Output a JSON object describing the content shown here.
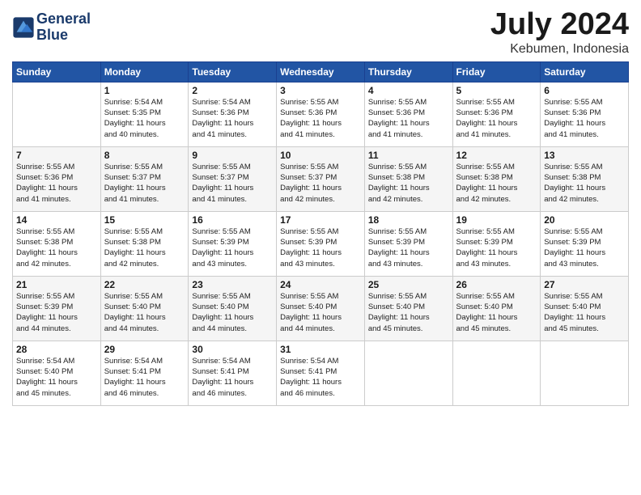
{
  "header": {
    "logo_line1": "General",
    "logo_line2": "Blue",
    "month_title": "July 2024",
    "location": "Kebumen, Indonesia"
  },
  "weekdays": [
    "Sunday",
    "Monday",
    "Tuesday",
    "Wednesday",
    "Thursday",
    "Friday",
    "Saturday"
  ],
  "weeks": [
    [
      {
        "day": "",
        "info": ""
      },
      {
        "day": "1",
        "info": "Sunrise: 5:54 AM\nSunset: 5:35 PM\nDaylight: 11 hours\nand 40 minutes."
      },
      {
        "day": "2",
        "info": "Sunrise: 5:54 AM\nSunset: 5:36 PM\nDaylight: 11 hours\nand 41 minutes."
      },
      {
        "day": "3",
        "info": "Sunrise: 5:55 AM\nSunset: 5:36 PM\nDaylight: 11 hours\nand 41 minutes."
      },
      {
        "day": "4",
        "info": "Sunrise: 5:55 AM\nSunset: 5:36 PM\nDaylight: 11 hours\nand 41 minutes."
      },
      {
        "day": "5",
        "info": "Sunrise: 5:55 AM\nSunset: 5:36 PM\nDaylight: 11 hours\nand 41 minutes."
      },
      {
        "day": "6",
        "info": "Sunrise: 5:55 AM\nSunset: 5:36 PM\nDaylight: 11 hours\nand 41 minutes."
      }
    ],
    [
      {
        "day": "7",
        "info": "Sunrise: 5:55 AM\nSunset: 5:36 PM\nDaylight: 11 hours\nand 41 minutes."
      },
      {
        "day": "8",
        "info": "Sunrise: 5:55 AM\nSunset: 5:37 PM\nDaylight: 11 hours\nand 41 minutes."
      },
      {
        "day": "9",
        "info": "Sunrise: 5:55 AM\nSunset: 5:37 PM\nDaylight: 11 hours\nand 41 minutes."
      },
      {
        "day": "10",
        "info": "Sunrise: 5:55 AM\nSunset: 5:37 PM\nDaylight: 11 hours\nand 42 minutes."
      },
      {
        "day": "11",
        "info": "Sunrise: 5:55 AM\nSunset: 5:38 PM\nDaylight: 11 hours\nand 42 minutes."
      },
      {
        "day": "12",
        "info": "Sunrise: 5:55 AM\nSunset: 5:38 PM\nDaylight: 11 hours\nand 42 minutes."
      },
      {
        "day": "13",
        "info": "Sunrise: 5:55 AM\nSunset: 5:38 PM\nDaylight: 11 hours\nand 42 minutes."
      }
    ],
    [
      {
        "day": "14",
        "info": "Sunrise: 5:55 AM\nSunset: 5:38 PM\nDaylight: 11 hours\nand 42 minutes."
      },
      {
        "day": "15",
        "info": "Sunrise: 5:55 AM\nSunset: 5:38 PM\nDaylight: 11 hours\nand 42 minutes."
      },
      {
        "day": "16",
        "info": "Sunrise: 5:55 AM\nSunset: 5:39 PM\nDaylight: 11 hours\nand 43 minutes."
      },
      {
        "day": "17",
        "info": "Sunrise: 5:55 AM\nSunset: 5:39 PM\nDaylight: 11 hours\nand 43 minutes."
      },
      {
        "day": "18",
        "info": "Sunrise: 5:55 AM\nSunset: 5:39 PM\nDaylight: 11 hours\nand 43 minutes."
      },
      {
        "day": "19",
        "info": "Sunrise: 5:55 AM\nSunset: 5:39 PM\nDaylight: 11 hours\nand 43 minutes."
      },
      {
        "day": "20",
        "info": "Sunrise: 5:55 AM\nSunset: 5:39 PM\nDaylight: 11 hours\nand 43 minutes."
      }
    ],
    [
      {
        "day": "21",
        "info": "Sunrise: 5:55 AM\nSunset: 5:39 PM\nDaylight: 11 hours\nand 44 minutes."
      },
      {
        "day": "22",
        "info": "Sunrise: 5:55 AM\nSunset: 5:40 PM\nDaylight: 11 hours\nand 44 minutes."
      },
      {
        "day": "23",
        "info": "Sunrise: 5:55 AM\nSunset: 5:40 PM\nDaylight: 11 hours\nand 44 minutes."
      },
      {
        "day": "24",
        "info": "Sunrise: 5:55 AM\nSunset: 5:40 PM\nDaylight: 11 hours\nand 44 minutes."
      },
      {
        "day": "25",
        "info": "Sunrise: 5:55 AM\nSunset: 5:40 PM\nDaylight: 11 hours\nand 45 minutes."
      },
      {
        "day": "26",
        "info": "Sunrise: 5:55 AM\nSunset: 5:40 PM\nDaylight: 11 hours\nand 45 minutes."
      },
      {
        "day": "27",
        "info": "Sunrise: 5:55 AM\nSunset: 5:40 PM\nDaylight: 11 hours\nand 45 minutes."
      }
    ],
    [
      {
        "day": "28",
        "info": "Sunrise: 5:54 AM\nSunset: 5:40 PM\nDaylight: 11 hours\nand 45 minutes."
      },
      {
        "day": "29",
        "info": "Sunrise: 5:54 AM\nSunset: 5:41 PM\nDaylight: 11 hours\nand 46 minutes."
      },
      {
        "day": "30",
        "info": "Sunrise: 5:54 AM\nSunset: 5:41 PM\nDaylight: 11 hours\nand 46 minutes."
      },
      {
        "day": "31",
        "info": "Sunrise: 5:54 AM\nSunset: 5:41 PM\nDaylight: 11 hours\nand 46 minutes."
      },
      {
        "day": "",
        "info": ""
      },
      {
        "day": "",
        "info": ""
      },
      {
        "day": "",
        "info": ""
      }
    ]
  ]
}
